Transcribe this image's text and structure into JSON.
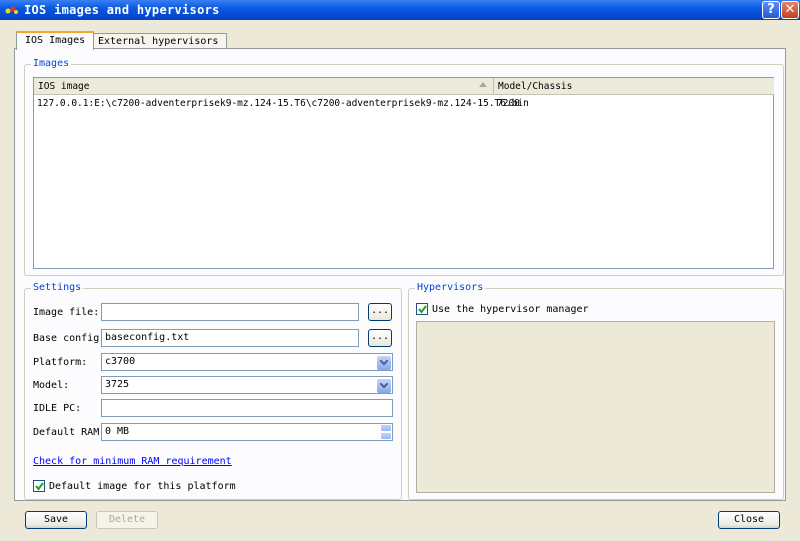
{
  "window": {
    "title": "IOS images and hypervisors",
    "help_label": "?",
    "close_label": "✕"
  },
  "tabs": [
    {
      "label": "IOS Images"
    },
    {
      "label": "External hypervisors"
    }
  ],
  "images": {
    "legend": "Images",
    "columns": [
      "IOS image",
      "Model/Chassis"
    ],
    "rows": [
      {
        "image": "127.0.0.1:E:\\c7200-adventerprisek9-mz.124-15.T6\\c7200-adventerprisek9-mz.124-15.T6.bin",
        "model": "7200"
      }
    ]
  },
  "settings": {
    "legend": "Settings",
    "image_file_label": "Image file:",
    "image_file_value": "",
    "base_config_label": "Base config:",
    "base_config_value": "baseconfig.txt",
    "browse_label": "...",
    "platform_label": "Platform:",
    "platform_value": "c3700",
    "model_label": "Model:",
    "model_value": "3725",
    "idle_pc_label": "IDLE PC:",
    "idle_pc_value": "",
    "default_ram_label": "Default RAM:",
    "default_ram_value": "0 MB",
    "ram_link": "Check for minimum RAM requirement",
    "default_image_label": "Default image for this platform",
    "default_image_checked": true
  },
  "hypervisors": {
    "legend": "Hypervisors",
    "use_manager_label": "Use the hypervisor manager",
    "use_manager_checked": true
  },
  "buttons": {
    "save": "Save",
    "delete": "Delete",
    "close": "Close"
  }
}
